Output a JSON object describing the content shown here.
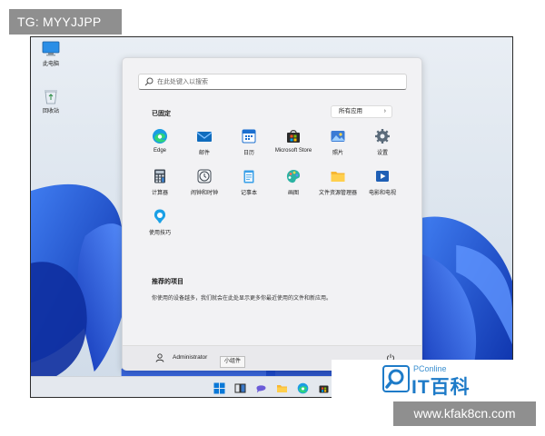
{
  "watermark_tag": "TG: MYYJJPP",
  "watermark_url": "www.kfak8cn.com",
  "desktop": {
    "icons": [
      {
        "label": "此电脑",
        "icon": "computer-icon"
      },
      {
        "label": "回收站",
        "icon": "recycle-bin-icon"
      }
    ]
  },
  "start_menu": {
    "search_placeholder": "在此处键入以搜索",
    "pinned_title": "已固定",
    "all_apps_label": "所有应用",
    "apps": [
      {
        "label": "Edge",
        "icon": "edge-icon"
      },
      {
        "label": "邮件",
        "icon": "mail-icon"
      },
      {
        "label": "日历",
        "icon": "calendar-icon"
      },
      {
        "label": "Microsoft Store",
        "icon": "store-icon"
      },
      {
        "label": "照片",
        "icon": "photos-icon"
      },
      {
        "label": "设置",
        "icon": "settings-icon"
      },
      {
        "label": "计算器",
        "icon": "calculator-icon"
      },
      {
        "label": "闹钟和时钟",
        "icon": "clock-icon"
      },
      {
        "label": "记事本",
        "icon": "notepad-icon"
      },
      {
        "label": "画图",
        "icon": "paint-icon"
      },
      {
        "label": "文件资源管理器",
        "icon": "folder-icon"
      },
      {
        "label": "电影和电视",
        "icon": "movies-icon"
      },
      {
        "label": "使用技巧",
        "icon": "tips-icon"
      }
    ],
    "recommended_title": "推荐的项目",
    "recommended_text": "你使用的设备越多，我们就会在此处显示更多你最近使用的文件和新应用。",
    "user_name": "Administrator"
  },
  "tooltip": "小组件",
  "brand": {
    "small": "PConline",
    "big": "IT百科"
  },
  "colors": {
    "accent": "#0067c0",
    "wallpaper_blue": "#1a4fd6"
  }
}
